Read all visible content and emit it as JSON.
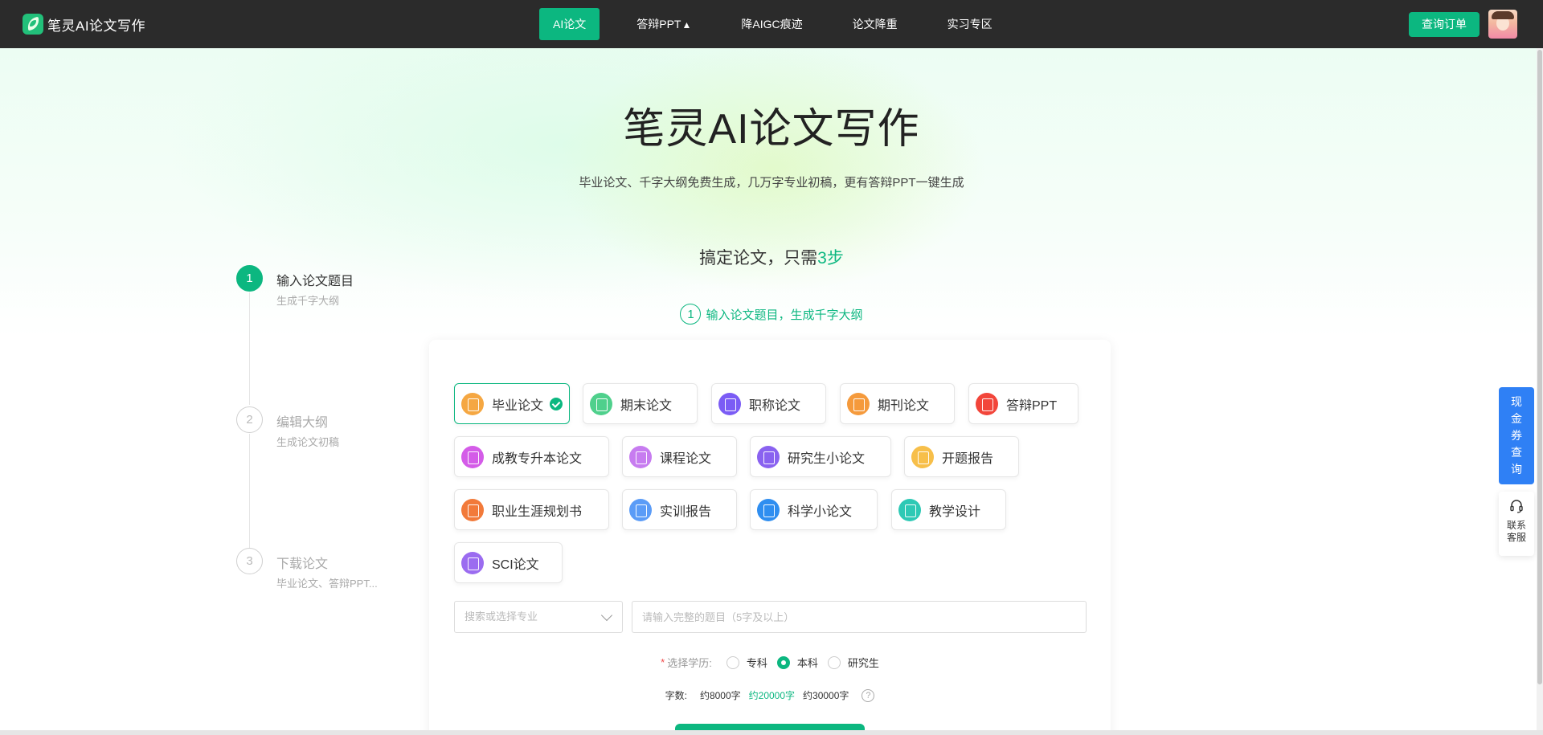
{
  "nav": {
    "brand": "笔灵AI论文写作",
    "items": [
      {
        "label": "AI论文",
        "active": true
      },
      {
        "label": "答辩PPT",
        "badge": "fire-icon"
      },
      {
        "label": "降AIGC痕迹"
      },
      {
        "label": "论文降重"
      },
      {
        "label": "实习专区"
      }
    ],
    "order_label": "查询订单"
  },
  "hero": {
    "title": "笔灵AI论文写作",
    "subtitle": "毕业论文、千字大纲免费生成，几万字专业初稿，更有答辩PPT一键生成",
    "steps_heading_prefix": "搞定论文，只需",
    "steps_heading_accent": "3步",
    "step_hint_num": "1",
    "step_hint_text": "输入论文题目，生成千字大纲"
  },
  "steps": [
    {
      "num": "1",
      "title": "输入论文题目",
      "sub": "生成千字大纲",
      "active": true
    },
    {
      "num": "2",
      "title": "编辑大纲",
      "sub": "生成论文初稿",
      "active": false
    },
    {
      "num": "3",
      "title": "下载论文",
      "sub": "毕业论文、答辩PPT...",
      "active": false
    }
  ],
  "types": [
    {
      "label": "毕业论文",
      "color": "#f5a742",
      "selected": true
    },
    {
      "label": "期末论文",
      "color": "#4fd08c"
    },
    {
      "label": "职称论文",
      "color": "#7b5cf5"
    },
    {
      "label": "期刊论文",
      "color": "#f59a3c"
    },
    {
      "label": "答辩PPT",
      "color": "#f2453a"
    },
    {
      "label": "成教专升本论文",
      "color": "#d45ce8"
    },
    {
      "label": "课程论文",
      "color": "#c77cf0"
    },
    {
      "label": "研究生小论文",
      "color": "#8a62f0"
    },
    {
      "label": "开题报告",
      "color": "#f7bf4a"
    },
    {
      "label": "职业生涯规划书",
      "color": "#f27a3a"
    },
    {
      "label": "实训报告",
      "color": "#5b9cf7"
    },
    {
      "label": "科学小论文",
      "color": "#2f8ef0"
    },
    {
      "label": "教学设计",
      "color": "#2ec9b5"
    },
    {
      "label": "SCI论文",
      "color": "#9b6cf0"
    }
  ],
  "form": {
    "major_placeholder": "搜索或选择专业",
    "title_placeholder": "请输入完整的题目（5字及以上）",
    "edu_required": "*",
    "edu_label": "选择学历:",
    "edu_options": [
      {
        "label": "专科",
        "checked": false
      },
      {
        "label": "本科",
        "checked": true
      },
      {
        "label": "研究生",
        "checked": false
      }
    ],
    "words_label": "字数:",
    "words_options": [
      {
        "label": "约8000字",
        "active": false
      },
      {
        "label": "约20000字",
        "active": true
      },
      {
        "label": "约30000字",
        "active": false
      }
    ],
    "help": "?"
  },
  "float": {
    "coupon": [
      "现",
      "金",
      "券",
      "查",
      "询"
    ],
    "cs_line1": "联系",
    "cs_line2": "客服"
  },
  "colors": {
    "accent": "#0cb780",
    "nav_bg": "#2b2b2b",
    "coupon_bg": "#2f80f5"
  }
}
